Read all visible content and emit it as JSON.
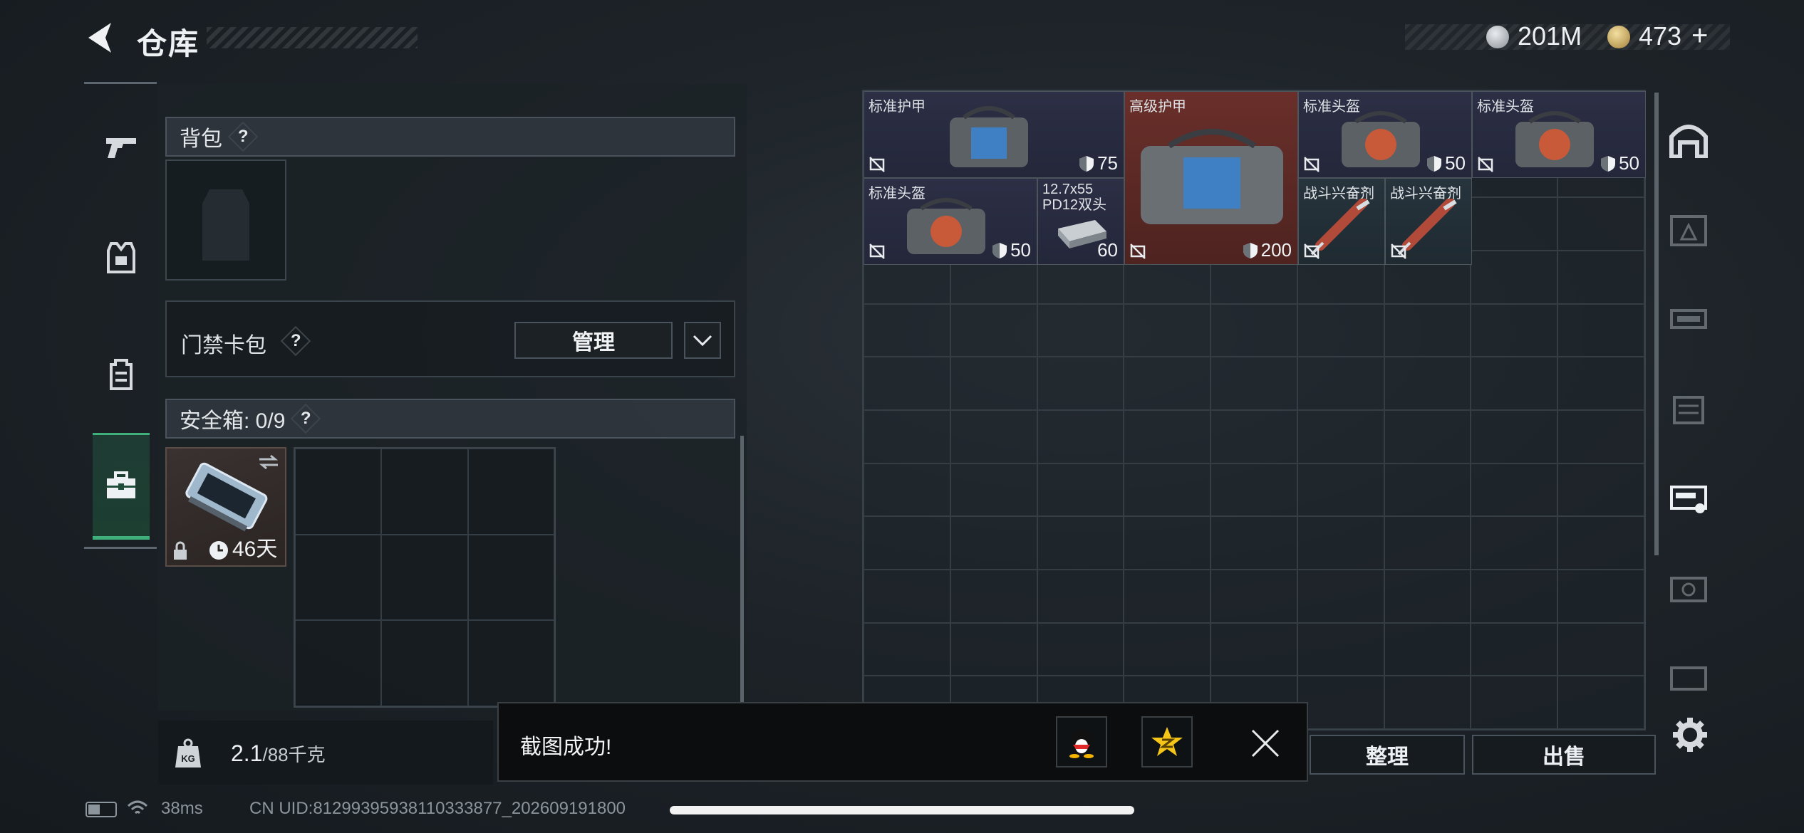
{
  "header": {
    "title": "仓库"
  },
  "currency": {
    "money": "201M",
    "coins": "473",
    "add": "+"
  },
  "sidebar": {
    "items": [
      {
        "name": "weapon",
        "icon": "pistol-icon"
      },
      {
        "name": "armor",
        "icon": "vest-icon"
      },
      {
        "name": "backpack",
        "icon": "backpack-icon"
      },
      {
        "name": "case",
        "icon": "briefcase-icon",
        "active": true
      }
    ]
  },
  "backpack": {
    "label": "背包",
    "help": "?"
  },
  "keycard": {
    "label": "门禁卡包",
    "help": "?",
    "manage": "管理"
  },
  "safebox": {
    "label": "安全箱: 0/9",
    "help": "?",
    "timer": "46天"
  },
  "weight": {
    "value": "2.1",
    "max": "/88千克"
  },
  "items": [
    {
      "label": "标准护甲",
      "value": "75",
      "type": "armor"
    },
    {
      "label": "高级护甲",
      "value": "200",
      "type": "armor"
    },
    {
      "label": "标准头盔",
      "value": "50",
      "type": "helmet"
    },
    {
      "label": "标准头盔",
      "value": "50",
      "type": "helmet"
    },
    {
      "label": "标准头盔",
      "value": "50",
      "type": "helmet"
    },
    {
      "label": "12.7x55",
      "sublabel": "PD12双头",
      "value": "60",
      "type": "ammo"
    },
    {
      "label": "战斗兴奋剂",
      "type": "stim"
    },
    {
      "label": "战斗兴奋剂",
      "type": "stim"
    }
  ],
  "actions": {
    "sort": "整理",
    "sell": "出售"
  },
  "toast": {
    "message": "截图成功!"
  },
  "status": {
    "ping": "38ms",
    "uid": "CN UID:8129939593811033387​7_202609191800"
  },
  "colors": {
    "accent": "#3fb07a",
    "high_tier": "#6a2f2a",
    "mid_tier": "#2c2f45",
    "stim_tier": "#27343d"
  }
}
